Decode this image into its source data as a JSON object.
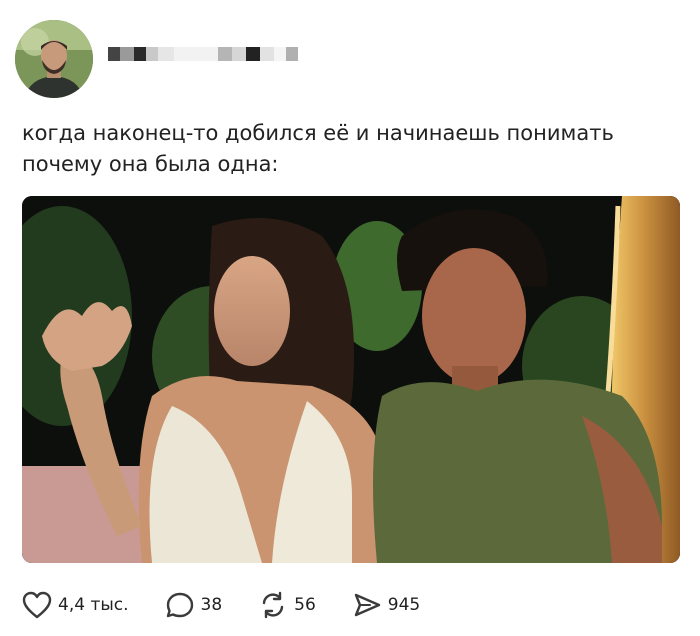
{
  "post": {
    "text": "когда наконец-то добился её и начинаешь понимать\nпочему она была одна:",
    "image_icon": "photo"
  },
  "author": {
    "avatar_icon": "avatar"
  },
  "actions": {
    "likes": "4,4 тыс.",
    "comments": "38",
    "reposts": "56",
    "views": "945"
  },
  "colors": {
    "text": "#1c1c1c",
    "icon": "#3b3b3b",
    "background": "#ffffff"
  }
}
